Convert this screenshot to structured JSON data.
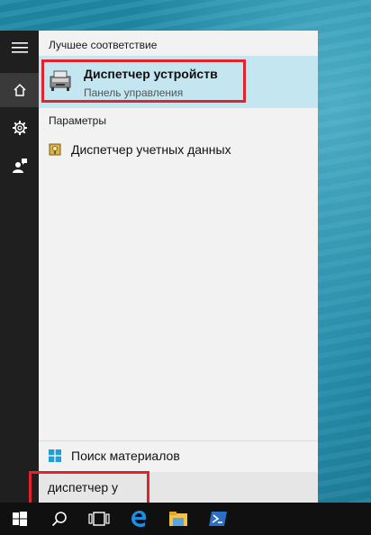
{
  "colors": {
    "accent": "#c3e6f0",
    "highlight_border": "#e1232b",
    "rail_bg": "#1f1f1f",
    "taskbar_bg": "#101010",
    "panel_bg": "#f2f2f2"
  },
  "left_rail": {
    "items": [
      {
        "icon": "hamburger-menu-icon"
      },
      {
        "icon": "home-icon"
      },
      {
        "icon": "gear-icon"
      },
      {
        "icon": "feedback-person-icon"
      }
    ]
  },
  "results": {
    "best_match_header": "Лучшее соответствие",
    "best_match": {
      "name": "Диспетчер устройств",
      "subtitle": "Панель управления",
      "icon": "device-manager-icon"
    },
    "settings_header": "Параметры",
    "settings_items": [
      {
        "label": "Диспетчер учетных данных",
        "icon": "credential-manager-icon"
      }
    ],
    "search_content_label": "Поиск материалов"
  },
  "search": {
    "value": "диспетчер у"
  },
  "taskbar": {
    "items": [
      {
        "icon": "windows-start-icon"
      },
      {
        "icon": "search-icon"
      },
      {
        "icon": "task-view-icon"
      },
      {
        "icon": "edge-browser-icon"
      },
      {
        "icon": "file-explorer-icon"
      },
      {
        "icon": "powershell-icon"
      }
    ]
  }
}
